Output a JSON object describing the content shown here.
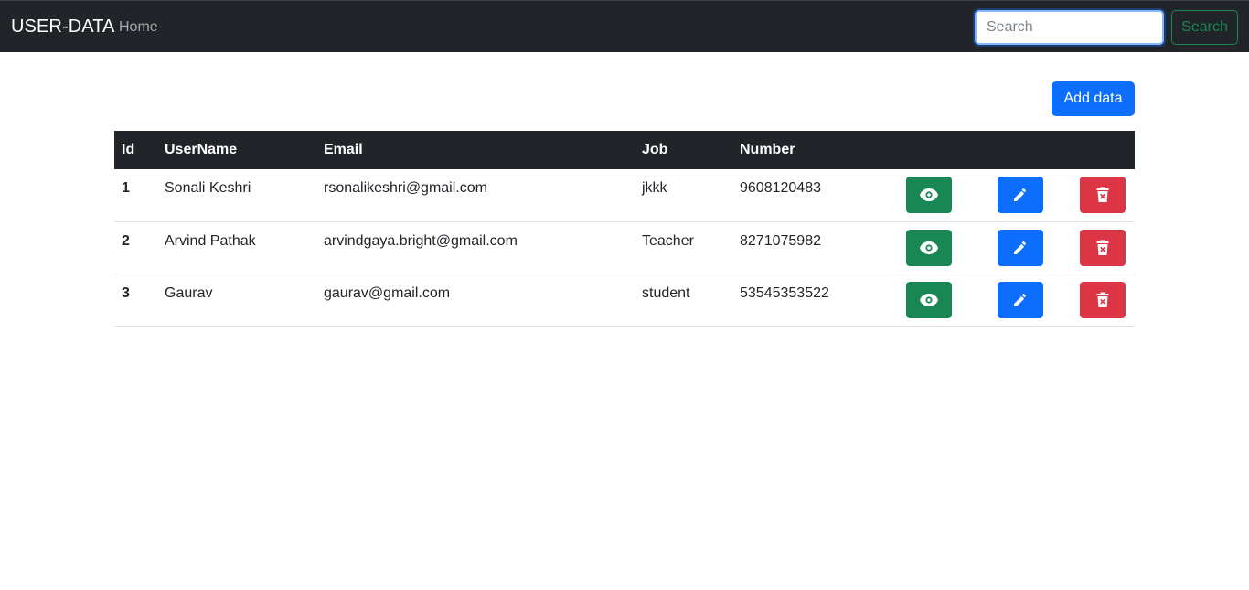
{
  "navbar": {
    "brand": "USER-DATA",
    "home_label": "Home",
    "search_placeholder": "Search",
    "search_value": "",
    "search_button_label": "Search"
  },
  "main": {
    "add_button_label": "Add data"
  },
  "table": {
    "headers": {
      "id": "Id",
      "username": "UserName",
      "email": "Email",
      "job": "Job",
      "number": "Number"
    },
    "rows": [
      {
        "id": "1",
        "username": "Sonali Keshri",
        "email": "rsonalikeshri@gmail.com",
        "job": "jkkk",
        "number": "9608120483"
      },
      {
        "id": "2",
        "username": "Arvind Pathak",
        "email": "arvindgaya.bright@gmail.com",
        "job": "Teacher",
        "number": "8271075982"
      },
      {
        "id": "3",
        "username": "Gaurav",
        "email": "gaurav@gmail.com",
        "job": "student",
        "number": "53545353522"
      }
    ],
    "actions": {
      "view_icon": "eye-icon",
      "edit_icon": "pencil-icon",
      "delete_icon": "trash-icon"
    }
  },
  "colors": {
    "navbar_bg": "#212529",
    "primary": "#0d6efd",
    "success": "#198754",
    "danger": "#dc3545"
  }
}
